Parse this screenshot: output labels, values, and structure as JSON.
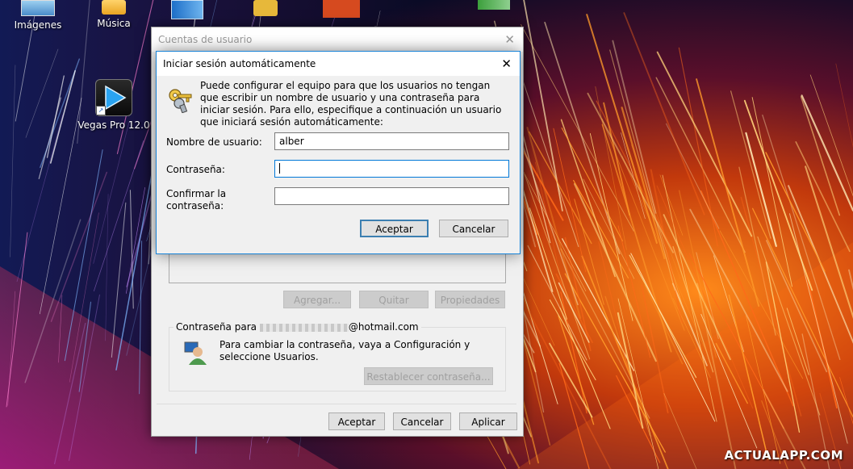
{
  "desktop": {
    "icons": [
      {
        "label": "Imágenes"
      },
      {
        "label": "Música"
      },
      {
        "label": "Vegas Pro 12.0"
      }
    ],
    "watermark": "ACTUALAPP.COM"
  },
  "back_dialog": {
    "title": "Cuentas de usuario",
    "buttons": {
      "add": "Agregar...",
      "remove": "Quitar",
      "properties": "Propiedades"
    },
    "password_group": {
      "legend_prefix": "Contraseña para",
      "legend_suffix": "@hotmail.com",
      "info_text": "Para cambiar la contraseña, vaya a Configuración y seleccione Usuarios.",
      "reset_button": "Restablecer contraseña..."
    },
    "footer": {
      "ok": "Aceptar",
      "cancel": "Cancelar",
      "apply": "Aplicar"
    }
  },
  "dialog": {
    "title": "Iniciar sesión automáticamente",
    "description": "Puede configurar el equipo para que los usuarios no tengan que escribir un nombre de usuario y una contraseña para iniciar sesión. Para ello, especifique a continuación un usuario que iniciará sesión automáticamente:",
    "fields": {
      "username": {
        "label": "Nombre de usuario:",
        "value": "alber"
      },
      "password": {
        "label": "Contraseña:",
        "value": ""
      },
      "confirm": {
        "label_line1": "Confirmar la",
        "label_line2": "contraseña:",
        "value": ""
      }
    },
    "buttons": {
      "ok": "Aceptar",
      "cancel": "Cancelar"
    }
  }
}
